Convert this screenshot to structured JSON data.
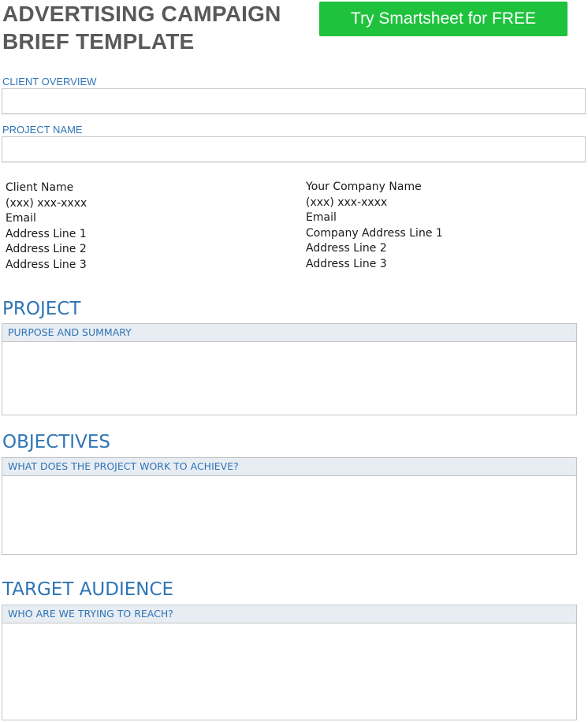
{
  "title": {
    "line1": "ADVERTISING CAMPAIGN",
    "line2": "BRIEF TEMPLATE"
  },
  "cta": {
    "label": "Try Smartsheet for FREE",
    "color": "#1ec23c"
  },
  "fields": {
    "client_overview": {
      "label": "CLIENT OVERVIEW",
      "value": ""
    },
    "project_name": {
      "label": "PROJECT NAME",
      "value": ""
    }
  },
  "client_contact": {
    "lines": [
      "Client Name",
      "(xxx) xxx-xxxx",
      "Email",
      "Address Line 1",
      "Address Line 2",
      "Address Line 3"
    ]
  },
  "company_contact": {
    "lines": [
      "Your Company Name",
      "(xxx) xxx-xxxx",
      "Email",
      "Company Address Line 1",
      "Address Line 2",
      "Address Line 3"
    ]
  },
  "sections": {
    "project": {
      "heading": "PROJECT",
      "subheading": "PURPOSE AND SUMMARY",
      "content": ""
    },
    "objectives": {
      "heading": "OBJECTIVES",
      "subheading": "WHAT DOES THE PROJECT WORK TO ACHIEVE?",
      "content": ""
    },
    "target_audience": {
      "heading": "TARGET AUDIENCE",
      "subheading": "WHO ARE WE TRYING TO REACH?",
      "content": ""
    }
  },
  "colors": {
    "accent_blue": "#2e75b6",
    "title_gray": "#595959",
    "subhead_fill": "#e8ecf3"
  }
}
